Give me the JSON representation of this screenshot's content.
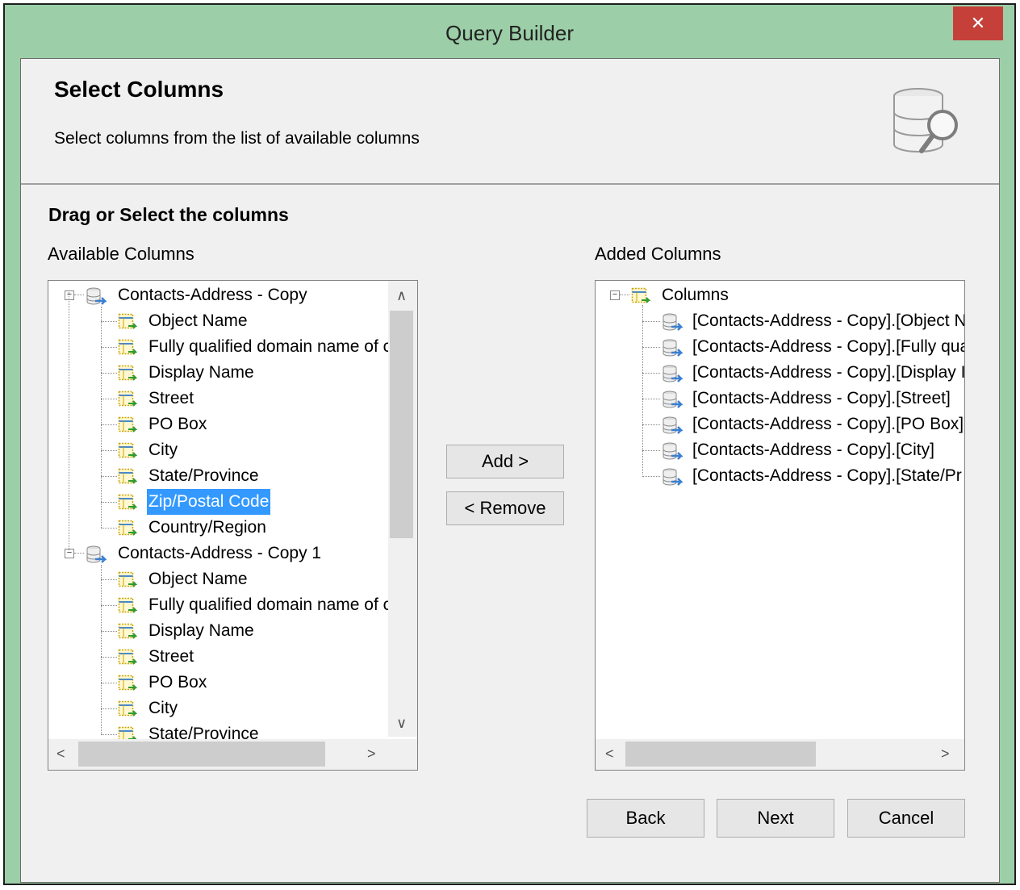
{
  "window": {
    "title": "Query Builder",
    "close_glyph": "✕"
  },
  "header": {
    "title": "Select Columns",
    "subtitle": "Select columns from the list of available columns",
    "icon": "database-search-icon"
  },
  "section_title": "Drag or Select the columns",
  "available": {
    "label": "Available Columns",
    "groups": [
      {
        "name": "Contacts-Address - Copy",
        "items": [
          "Object Name",
          "Fully qualified domain name of c",
          "Display Name",
          "Street",
          "PO Box",
          "City",
          "State/Province",
          "Zip/Postal Code",
          "Country/Region"
        ]
      },
      {
        "name": "Contacts-Address - Copy 1",
        "items": [
          "Object Name",
          "Fully qualified domain name of c",
          "Display Name",
          "Street",
          "PO Box",
          "City",
          "State/Province"
        ]
      }
    ],
    "selected_item": "Zip/Postal Code"
  },
  "added": {
    "label": "Added Columns",
    "root": "Columns",
    "items": [
      "[Contacts-Address - Copy].[Object N",
      "[Contacts-Address - Copy].[Fully qua",
      "[Contacts-Address - Copy].[Display I",
      "[Contacts-Address - Copy].[Street]",
      "[Contacts-Address - Copy].[PO Box]",
      "[Contacts-Address - Copy].[City]",
      "[Contacts-Address - Copy].[State/Pr"
    ]
  },
  "buttons": {
    "add": "Add >",
    "remove": "< Remove",
    "back": "Back",
    "next": "Next",
    "cancel": "Cancel"
  },
  "colors": {
    "frame": "#9ccfa8",
    "close": "#c6403a",
    "selection": "#3399ff"
  }
}
